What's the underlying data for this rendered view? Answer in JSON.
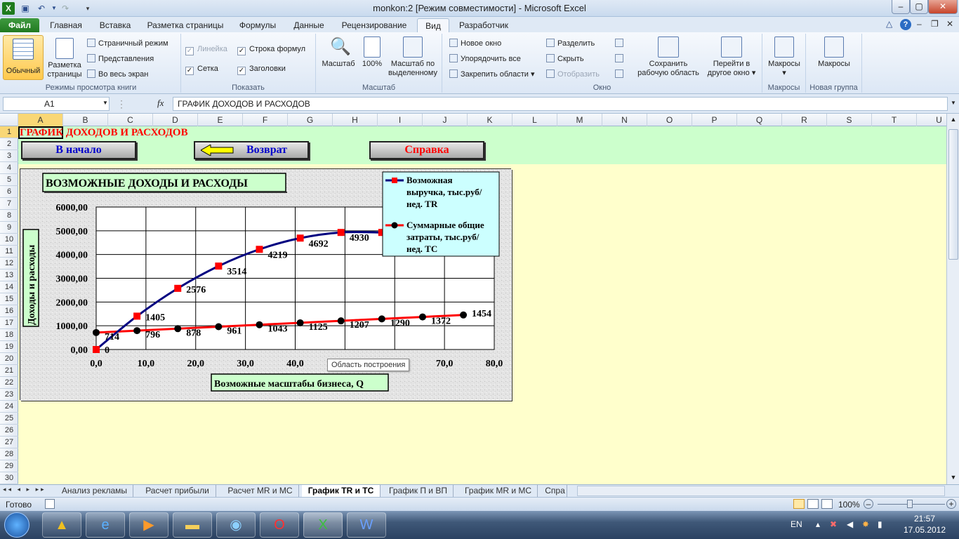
{
  "window": {
    "title": "monkon:2  [Режим совместимости]  -  Microsoft Excel",
    "app_icon": "excel-icon"
  },
  "tabs": [
    "Файл",
    "Главная",
    "Вставка",
    "Разметка страницы",
    "Формулы",
    "Данные",
    "Рецензирование",
    "Вид",
    "Разработчик"
  ],
  "ribbon": {
    "views": {
      "normal": "Обычный",
      "page_layout_1": "Разметка",
      "page_layout_2": "страницы",
      "page_break": "Страничный режим",
      "custom": "Представления",
      "fullscreen": "Во весь экран",
      "label": "Режимы просмотра книги"
    },
    "show": {
      "ruler": "Линейка",
      "formula_bar": "Строка формул",
      "gridlines": "Сетка",
      "headings": "Заголовки",
      "label": "Показать"
    },
    "zoom": {
      "zoom": "Масштаб",
      "hundred": "100%",
      "selection_1": "Масштаб по",
      "selection_2": "выделенному",
      "label": "Масштаб"
    },
    "window": {
      "new": "Новое окно",
      "arrange": "Упорядочить все",
      "freeze": "Закрепить области",
      "split": "Разделить",
      "hide": "Скрыть",
      "unhide": "Отобразить",
      "save_1": "Сохранить",
      "save_2": "рабочую область",
      "switch_1": "Перейти в",
      "switch_2": "другое окно",
      "label": "Окно"
    },
    "macros": {
      "macros": "Макросы",
      "label": "Макросы",
      "macros2": "Макросы",
      "label2": "Новая группа"
    }
  },
  "formula": {
    "name_box": "A1",
    "fx": "fx",
    "content": "ГРАФИК ДОХОДОВ И РАСХОДОВ"
  },
  "columns": [
    "A",
    "B",
    "C",
    "D",
    "E",
    "F",
    "G",
    "H",
    "I",
    "J",
    "K",
    "L",
    "M",
    "N",
    "O",
    "P",
    "Q",
    "R",
    "S",
    "T",
    "U"
  ],
  "rows": [
    "1",
    "2",
    "3",
    "4",
    "5",
    "6",
    "7",
    "8",
    "9",
    "10",
    "11",
    "12",
    "13",
    "14",
    "15",
    "16",
    "17",
    "18",
    "19",
    "20",
    "21",
    "22",
    "23",
    "24",
    "25",
    "26",
    "27",
    "28",
    "29",
    "30"
  ],
  "sheet": {
    "header": "ГРАФИК ДОХОДОВ И РАСХОДОВ",
    "btn_start": "В начало",
    "btn_back": "Возврат",
    "btn_help": "Справка",
    "tooltip": "Область построения"
  },
  "chart_data": {
    "type": "line",
    "title": "ВОЗМОЖНЫЕ ДОХОДЫ И РАСХОДЫ",
    "xlabel": "Возможные масштабы бизнеса, Q",
    "ylabel": "Доходы и расходы",
    "xlim": [
      0,
      80
    ],
    "ylim": [
      0,
      6000
    ],
    "x_ticks": [
      "0,0",
      "10,0",
      "20,0",
      "30,0",
      "40,0",
      "50,0",
      "60,0",
      "70,0",
      "80,0"
    ],
    "y_ticks": [
      "0,00",
      "1000,00",
      "2000,00",
      "3000,00",
      "4000,00",
      "5000,00",
      "6000,00"
    ],
    "x": [
      0,
      8.2,
      16.4,
      24.6,
      32.8,
      41,
      49.2,
      57.4,
      65.6,
      73.8
    ],
    "series": [
      {
        "name": "Возможная выручка, тыс.руб/нед. TR",
        "name_lines": [
          "Возможная",
          "выручка, тыс.руб/",
          "нед. TR"
        ],
        "color": "#000080",
        "marker": "square",
        "marker_color": "#ff0000",
        "values": [
          0,
          1405,
          2576,
          3514,
          4219,
          4692,
          4930,
          4930
        ],
        "labels": [
          "0",
          "1405",
          "2576",
          "3514",
          "4219",
          "4692",
          "4930",
          ""
        ]
      },
      {
        "name": "Суммарные общие затраты, тыс.руб/нед. TC",
        "name_lines": [
          "Суммарные общие",
          "затраты, тыс.руб/",
          "нед. TC"
        ],
        "color": "#ff0000",
        "marker": "circle",
        "marker_color": "#000000",
        "values": [
          714,
          796,
          878,
          961,
          1043,
          1125,
          1207,
          1290,
          1372,
          1454
        ],
        "labels": [
          "714",
          "796",
          "878",
          "961",
          "1043",
          "1125",
          "1207",
          "1290",
          "1372",
          "1454"
        ]
      }
    ],
    "grid": true,
    "legend": "top-right"
  },
  "sheet_tabs": [
    "Анализ рекламы",
    "Расчет прибыли",
    "Расчет MR и MC",
    "График TR и TC",
    "График П и ВП",
    "График MR и MC",
    "Спра"
  ],
  "active_sheet": "График TR и TC",
  "status": {
    "ready": "Готово",
    "zoom": "100%"
  },
  "taskbar": {
    "lang": "EN",
    "time": "21:57",
    "date": "17.05.2012"
  }
}
